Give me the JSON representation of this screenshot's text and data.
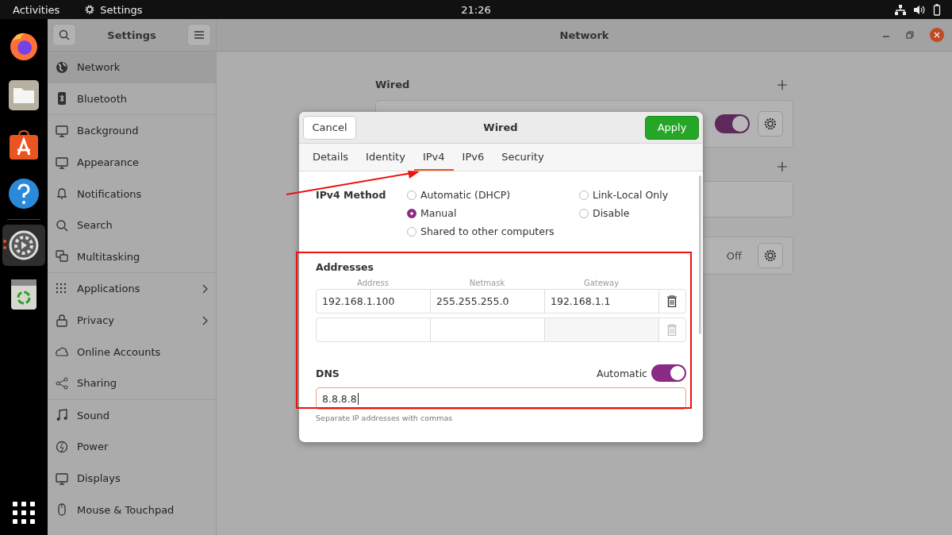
{
  "top_bar": {
    "activities": "Activities",
    "app_name": "Settings",
    "clock": "21:26"
  },
  "dock": [
    {
      "kind": "browser",
      "selected": false
    },
    {
      "kind": "files",
      "selected": false
    },
    {
      "kind": "store",
      "selected": false
    },
    {
      "kind": "help",
      "selected": false
    },
    {
      "kind": "settings",
      "selected": true
    },
    {
      "kind": "trash",
      "selected": false
    }
  ],
  "sidebar": {
    "title": "Settings",
    "groups": [
      [
        {
          "label": "Network",
          "selected": true,
          "chevron": false
        },
        {
          "label": "Bluetooth",
          "selected": false,
          "chevron": false
        }
      ],
      [
        {
          "label": "Background",
          "selected": false,
          "chevron": false
        },
        {
          "label": "Appearance",
          "selected": false,
          "chevron": false
        },
        {
          "label": "Notifications",
          "selected": false,
          "chevron": false
        },
        {
          "label": "Search",
          "selected": false,
          "chevron": false
        },
        {
          "label": "Multitasking",
          "selected": false,
          "chevron": false
        }
      ],
      [
        {
          "label": "Applications",
          "selected": false,
          "chevron": true
        },
        {
          "label": "Privacy",
          "selected": false,
          "chevron": true
        },
        {
          "label": "Online Accounts",
          "selected": false,
          "chevron": false
        },
        {
          "label": "Sharing",
          "selected": false,
          "chevron": false
        }
      ],
      [
        {
          "label": "Sound",
          "selected": false,
          "chevron": false
        },
        {
          "label": "Power",
          "selected": false,
          "chevron": false
        },
        {
          "label": "Displays",
          "selected": false,
          "chevron": false
        },
        {
          "label": "Mouse & Touchpad",
          "selected": false,
          "chevron": false
        }
      ]
    ]
  },
  "main": {
    "title": "Network",
    "wired_title": "Wired",
    "wired_on": true,
    "proxy_state": "Off"
  },
  "dialog": {
    "cancel": "Cancel",
    "title": "Wired",
    "apply": "Apply",
    "tabs": [
      {
        "label": "Details",
        "selected": false
      },
      {
        "label": "Identity",
        "selected": false
      },
      {
        "label": "IPv4",
        "selected": true
      },
      {
        "label": "IPv6",
        "selected": false
      },
      {
        "label": "Security",
        "selected": false
      }
    ],
    "method_label": "IPv4 Method",
    "methods": [
      {
        "label": "Automatic (DHCP)",
        "selected": false
      },
      {
        "label": "Link-Local Only",
        "selected": false
      },
      {
        "label": "Manual",
        "selected": true
      },
      {
        "label": "Disable",
        "selected": false
      },
      {
        "label": "Shared to other computers",
        "selected": false
      }
    ],
    "addresses_title": "Addresses",
    "columns": [
      "Address",
      "Netmask",
      "Gateway"
    ],
    "rows": [
      {
        "address": "192.168.1.100",
        "netmask": "255.255.255.0",
        "gateway": "192.168.1.1"
      }
    ],
    "dns_label": "DNS",
    "dns_automatic_label": "Automatic",
    "dns_automatic_on": true,
    "dns_value": "8.8.8.8",
    "dns_hint": "Separate IP addresses with commas"
  }
}
